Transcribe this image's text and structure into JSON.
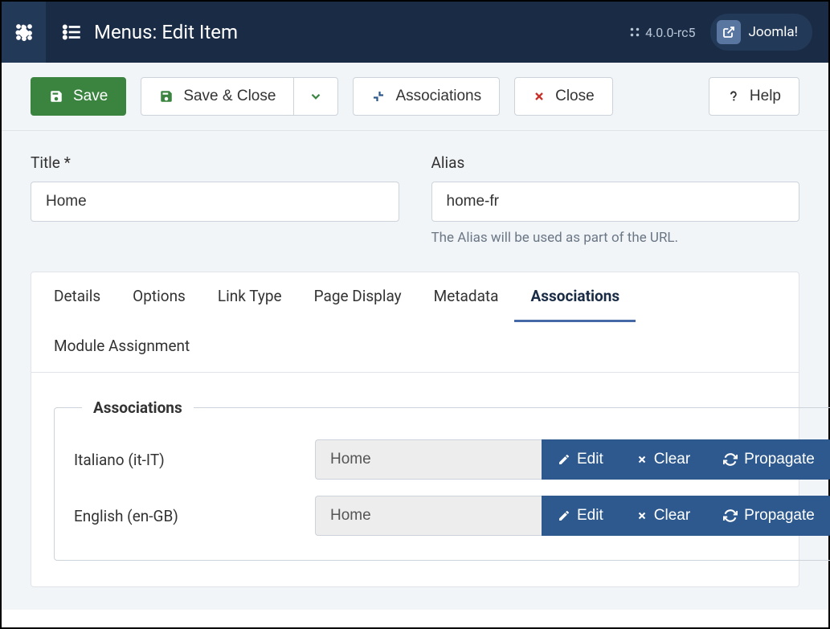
{
  "topbar": {
    "title": "Menus: Edit Item",
    "version": "4.0.0-rc5",
    "brand_link": "Joomla!"
  },
  "toolbar": {
    "save": "Save",
    "save_close": "Save & Close",
    "associations": "Associations",
    "close": "Close",
    "help": "Help"
  },
  "fields": {
    "title_label": "Title *",
    "title_value": "Home",
    "alias_label": "Alias",
    "alias_value": "home-fr",
    "alias_help": "The Alias will be used as part of the URL."
  },
  "tabs": {
    "details": "Details",
    "options": "Options",
    "link_type": "Link Type",
    "page_display": "Page Display",
    "metadata": "Metadata",
    "associations": "Associations",
    "module_assignment": "Module Assignment"
  },
  "associations": {
    "legend": "Associations",
    "edit": "Edit",
    "clear": "Clear",
    "propagate": "Propagate",
    "rows": [
      {
        "label": "Italiano (it-IT)",
        "value": "Home"
      },
      {
        "label": "English (en-GB)",
        "value": "Home"
      }
    ]
  }
}
